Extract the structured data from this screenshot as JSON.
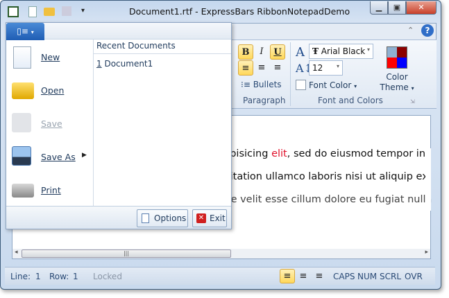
{
  "window": {
    "title": "Document1.rtf - ExpressBars RibbonNotepadDemo"
  },
  "ribbon": {
    "paragraph": {
      "bold": "B",
      "italic": "I",
      "underline": "U",
      "bullets": "Bullets",
      "label": "Paragraph"
    },
    "font": {
      "font_name": "Arial Black",
      "font_size": "12",
      "font_color": "Font Color",
      "label": "Font and Colors"
    },
    "color_theme": {
      "line1": "Color",
      "line2": "Theme",
      "swatches": [
        "#8fb0d0",
        "#8b0000",
        "#ff0000",
        "#0000ff"
      ]
    }
  },
  "document": {
    "lines": [
      {
        "before": "dipisicing ",
        "red": "elit",
        "after": ", sed do eiusmod tempor in"
      },
      {
        "before": "rcitation ullamco laboris nisi ut aliquip ex"
      },
      {
        "before": "ate velit esse cillum dolore eu fugiat nulla"
      }
    ]
  },
  "app_menu": {
    "items": [
      {
        "label": "New"
      },
      {
        "label": "Open"
      },
      {
        "label": "Save",
        "disabled": true
      },
      {
        "label": "Save As"
      },
      {
        "label": "Print"
      }
    ],
    "recent_title": "Recent Documents",
    "recent": [
      {
        "num": "1",
        "name": "Document1"
      }
    ],
    "options": "Options",
    "exit": "Exit"
  },
  "status": {
    "line_label": "Line:",
    "line": "1",
    "row_label": "Row:",
    "row": "1",
    "locked": "Locked",
    "indicators": [
      "CAPS",
      "NUM",
      "SCRL",
      "OVR"
    ]
  }
}
